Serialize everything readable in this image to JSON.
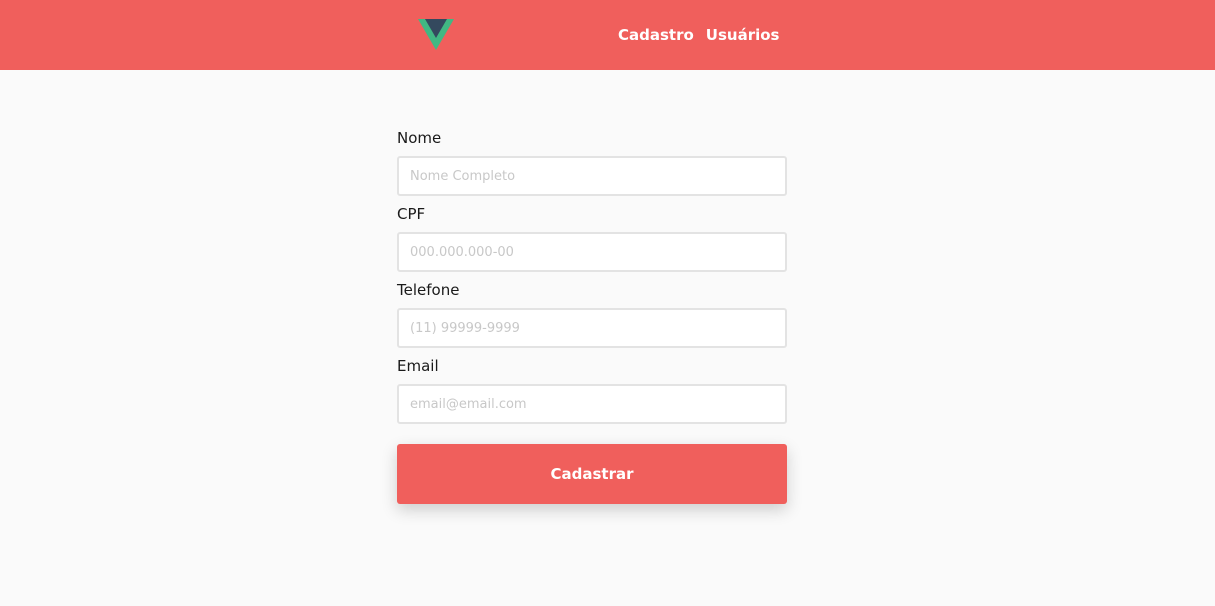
{
  "header": {
    "logo_icon": "vue-logo-icon",
    "colors": {
      "background": "#f05f5c",
      "logo_outer": "#34495e",
      "logo_inner": "#41b883"
    },
    "nav": [
      {
        "label": "Cadastro"
      },
      {
        "label": "Usuários"
      }
    ]
  },
  "form": {
    "fields": [
      {
        "label": "Nome",
        "placeholder": "Nome Completo",
        "value": ""
      },
      {
        "label": "CPF",
        "placeholder": "000.000.000-00",
        "value": ""
      },
      {
        "label": "Telefone",
        "placeholder": "(11) 99999-9999",
        "value": ""
      },
      {
        "label": "Email",
        "placeholder": "email@email.com",
        "value": ""
      }
    ],
    "submit_label": "Cadastrar",
    "submit_color": "#f05f5c"
  }
}
